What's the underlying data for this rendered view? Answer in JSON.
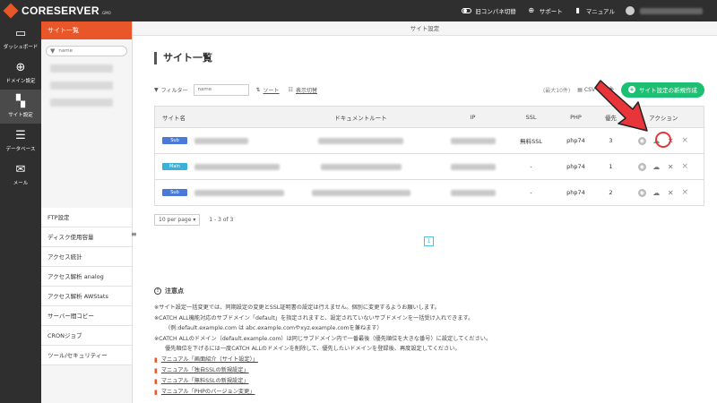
{
  "app": {
    "logo_text": "CORESERVER",
    "logo_sub": ".GMO"
  },
  "topbar": {
    "old_panel_label": "旧コンパネ切替",
    "support_label": "サポート",
    "manual_label": "マニュアル"
  },
  "iconnav": [
    {
      "label": "ダッシュボード",
      "icon": "monitor-icon"
    },
    {
      "label": "ドメイン設定",
      "icon": "globe-icon"
    },
    {
      "label": "サイト設定",
      "icon": "grid-icon"
    },
    {
      "label": "データベース",
      "icon": "database-icon"
    },
    {
      "label": "メール",
      "icon": "mail-icon"
    }
  ],
  "subsidebar": {
    "header": "サイト一覧",
    "search_placeholder": "name",
    "menu": [
      "FTP設定",
      "ディスク使用容量",
      "アクセス統計",
      "アクセス解析 analog",
      "アクセス解析 AWStats",
      "サーバー間コピー",
      "CRONジョブ",
      "ツール/セキュリティー"
    ]
  },
  "main": {
    "header": "サイト設定",
    "title": "サイト一覧",
    "toolbar": {
      "filter_label": "フィルター",
      "filter_placeholder": "name",
      "sort_label": "ソート",
      "display_label": "表示切替",
      "max_label": "(最大10件)",
      "csv_label": "CSV",
      "new_button": "サイト設定の新規作成"
    },
    "table": {
      "headers": [
        "サイト名",
        "ドキュメントルート",
        "IP",
        "SSL",
        "PHP",
        "優先",
        "アクション"
      ],
      "rows": [
        {
          "badge": "Sub",
          "ssl": "無料SSL",
          "php": "php74",
          "priority": "3"
        },
        {
          "badge": "Main",
          "ssl": "-",
          "php": "php74",
          "priority": "1"
        },
        {
          "badge": "Sub",
          "ssl": "-",
          "php": "php74",
          "priority": "2"
        }
      ]
    },
    "pager": {
      "per_page": "10 per page",
      "range": "1 - 3 of 3",
      "current_page": "1"
    },
    "notes": {
      "title": "注意点",
      "lines": [
        "※サイト設定一括変更では、同期設定の変更とSSL証明書の設定は行えません。個別に変更するようお願いします。",
        "※CATCH ALL機能対応のサブドメイン「default」を指定されますと、設定されていないサブドメインを一括受け入れできます。",
        "（例:default.example.com は abc.example.comやxyz.example.comを兼ねます）",
        "※CATCH ALLのドメイン（default.example.com）は同じサブドメイン内で一番最後（優先順位を大きな番号）に設定してください。",
        "優先順位を下げるには一度CATCH ALLのドメインを削除して、優先したいドメインを登録後、再度設定してください。"
      ],
      "links": [
        "マニュアル「画面紹介（サイト設定）」",
        "マニュアル「独自SSLの新規設定」",
        "マニュアル「無料SSLの新規設定」",
        "マニュアル「PHPのバージョン変更」"
      ]
    }
  },
  "colors": {
    "accent": "#e8562a",
    "primary_button": "#1dbf73",
    "highlight": "#e8353a"
  }
}
